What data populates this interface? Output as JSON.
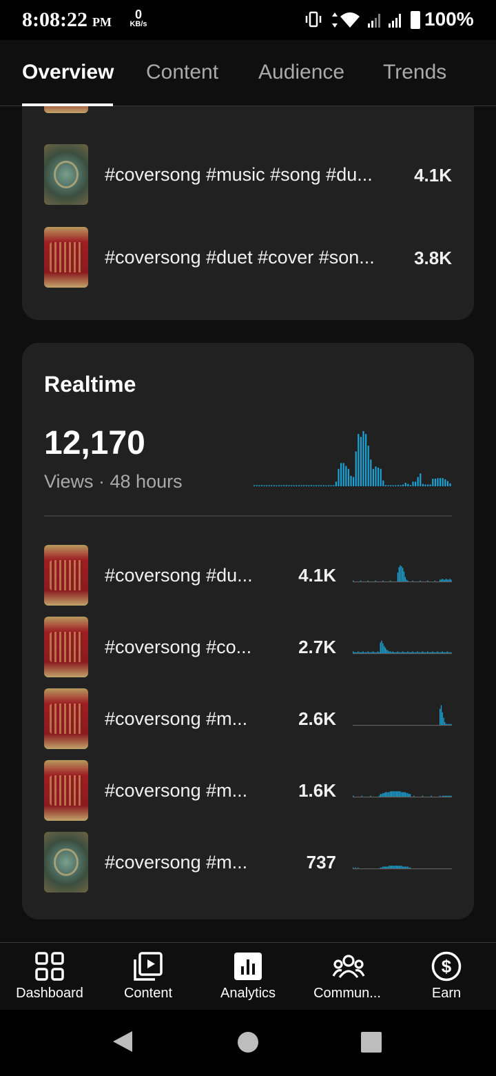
{
  "status_bar": {
    "time": "8:08:22",
    "ampm": "PM",
    "speed_value": "0",
    "speed_unit": "KB/s",
    "battery": "100%"
  },
  "tabs": [
    {
      "label": "Overview",
      "active": true
    },
    {
      "label": "Content",
      "active": false
    },
    {
      "label": "Audience",
      "active": false
    },
    {
      "label": "Trends",
      "active": false
    }
  ],
  "top_content": {
    "rows": [
      {
        "title": "#coversong #music #song #du...",
        "value": "4.1K",
        "thumb": "teal"
      },
      {
        "title": "#coversong #duet #cover #son...",
        "value": "3.8K",
        "thumb": "red"
      }
    ]
  },
  "realtime": {
    "title": "Realtime",
    "views": "12,170",
    "subtitle": "Views · 48 hours",
    "rows": [
      {
        "title": "#coversong #du...",
        "value": "4.1K",
        "thumb": "red"
      },
      {
        "title": "#coversong #co...",
        "value": "2.7K",
        "thumb": "red"
      },
      {
        "title": "#coversong #m...",
        "value": "2.6K",
        "thumb": "red"
      },
      {
        "title": "#coversong #m...",
        "value": "1.6K",
        "thumb": "red"
      },
      {
        "title": "#coversong #m...",
        "value": "737",
        "thumb": "teal"
      }
    ]
  },
  "chart_data": [
    {
      "type": "bar",
      "series": [
        {
          "values": [
            1,
            1,
            1,
            1,
            1,
            1,
            1,
            1,
            1,
            1,
            1,
            1,
            1,
            1,
            1,
            1,
            1,
            1,
            1,
            0,
            0,
            0,
            1,
            1,
            1,
            1,
            1,
            1,
            1,
            1,
            1,
            1,
            1,
            8,
            30,
            40,
            40,
            35,
            30,
            18,
            16,
            60,
            90,
            85,
            95,
            90,
            70,
            46,
            30,
            34,
            32,
            30,
            10,
            2,
            1,
            1,
            1,
            1,
            2,
            2,
            3,
            6,
            4,
            2,
            8,
            8,
            16,
            22,
            4,
            3,
            3,
            3,
            13,
            13,
            14,
            14,
            14,
            12,
            9,
            5
          ]
        }
      ],
      "accent": "#1aa3d6"
    }
  ],
  "bottom_nav": [
    {
      "label": "Dashboard",
      "icon": "dashboard-icon"
    },
    {
      "label": "Content",
      "icon": "content-icon"
    },
    {
      "label": "Analytics",
      "icon": "analytics-icon"
    },
    {
      "label": "Commun...",
      "icon": "community-icon"
    },
    {
      "label": "Earn",
      "icon": "earn-icon"
    }
  ],
  "colors": {
    "background": "#0f0f0f",
    "card": "#212121",
    "accent": "#1aa3d6",
    "muted_text": "#aaaaaa"
  }
}
